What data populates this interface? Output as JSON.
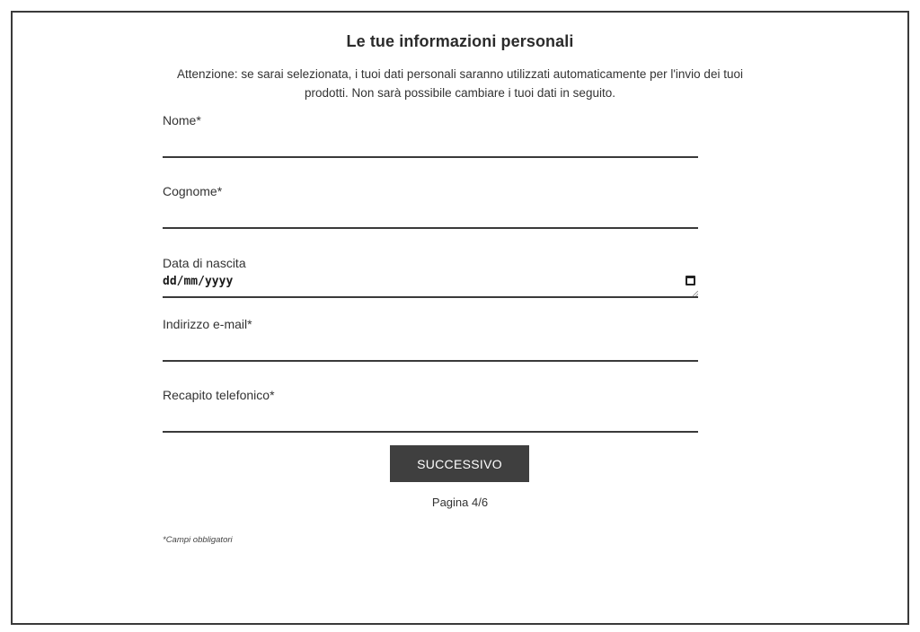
{
  "form": {
    "title": "Le tue informazioni personali",
    "notice": "Attenzione: se sarai selezionata, i tuoi dati personali saranno utilizzati automaticamente per l'invio dei tuoi prodotti. Non sarà possibile cambiare i tuoi dati in seguito.",
    "fields": [
      {
        "label": "Nome*",
        "value": ""
      },
      {
        "label": "Cognome*",
        "value": ""
      },
      {
        "label": "Data di nascita",
        "value": "dd/mm/yyyy",
        "icon": "calendar-icon"
      },
      {
        "label": "Indirizzo e-mail*",
        "value": ""
      },
      {
        "label": "Recapito telefonico*",
        "value": ""
      }
    ],
    "next_button": "SUCCESSIVO",
    "page_indicator": "Pagina 4/6",
    "required_note": "*Campi obbligatori"
  },
  "colors": {
    "button_bg": "#3f3f3f",
    "border": "#3a3a3a",
    "text": "#2b2b2b"
  }
}
